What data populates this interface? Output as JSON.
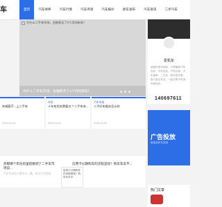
{
  "logo": "车",
  "nav": [
    "首页",
    "汽车保养",
    "汽车行情",
    "汽车评测",
    "汽车报价",
    "新车发布",
    "汽车资讯",
    "二手汽车"
  ],
  "hero": {
    "alt": "为什么二手车市场，会推断买了3个月的新车？",
    "caption": "为什么二手车市场，会推断买了3个月的新车？"
  },
  "cards": [
    {
      "title": "车辆要不...上二手车",
      "meta": "2025.03.24"
    },
    {
      "tag": "车险",
      "title": "十年车险的费要对 ? 二手车车...",
      "meta": "2025.03.18"
    },
    {
      "tag": "车险",
      "title": "信用卡分期购车的流程是啥？购车车...",
      "meta": "车险"
    },
    {
      "tag": "汽车市场",
      "title": "二手好车服务怎么样",
      "meta": "2025.03.16"
    }
  ],
  "thumbs": {
    "t1": "买那哪个年份的里程数到了二手车市场说...",
    "t1m": "汽车市场怎么看车从一看，加点汽车里程",
    "t3": "信用卡分期购车的流程是啥？购车车车不... ",
    "box": "信用卡分期购车的流程是啥？购车车车不..."
  },
  "sidebar": {
    "name": "爱机车",
    "desc": "我爱车资讯网站，分享最新汽车知识，汽车资讯，汽车评测，汽车保养，二手车，新车发布等，愿与各位车友，一起分享汽车资讯和知识。",
    "number": "140697611",
    "ad_title": "广告投放",
    "ad_sub": "欢迎合作与交流",
    "hot_title": "热门文章"
  }
}
